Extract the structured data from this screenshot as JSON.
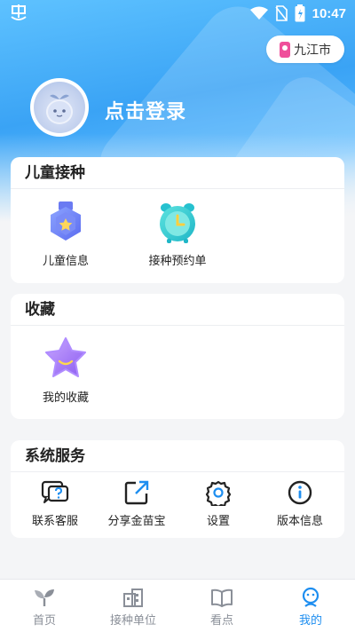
{
  "status_bar": {
    "time": "10:47"
  },
  "header": {
    "city": "九江市",
    "login_label": "点击登录"
  },
  "child_vaccination": {
    "title": "儿童接种",
    "items": [
      {
        "label": "儿童信息",
        "icon": "medal-badge-icon"
      },
      {
        "label": "接种预约单",
        "icon": "alarm-clock-icon"
      }
    ]
  },
  "favorites": {
    "title": "收藏",
    "items": [
      {
        "label": "我的收藏",
        "icon": "star-icon"
      }
    ]
  },
  "system_services": {
    "title": "系统服务",
    "items": [
      {
        "label": "联系客服",
        "icon": "chat-question-icon"
      },
      {
        "label": "分享金苗宝",
        "icon": "share-icon"
      },
      {
        "label": "设置",
        "icon": "gear-icon"
      },
      {
        "label": "版本信息",
        "icon": "info-icon"
      }
    ]
  },
  "tabbar": {
    "tabs": [
      {
        "label": "首页",
        "icon": "sprout-icon",
        "active": false
      },
      {
        "label": "接种单位",
        "icon": "building-icon",
        "active": false
      },
      {
        "label": "看点",
        "icon": "book-icon",
        "active": false
      },
      {
        "label": "我的",
        "icon": "profile-icon",
        "active": true
      }
    ],
    "active_color": "#1e8ef0",
    "inactive_color": "#8a8f98"
  },
  "colors": {
    "header_blue": "#3aa3f5",
    "accent_blue": "#1e8ef0",
    "card_bg": "#ffffff",
    "page_bg": "#f4f5f7"
  }
}
